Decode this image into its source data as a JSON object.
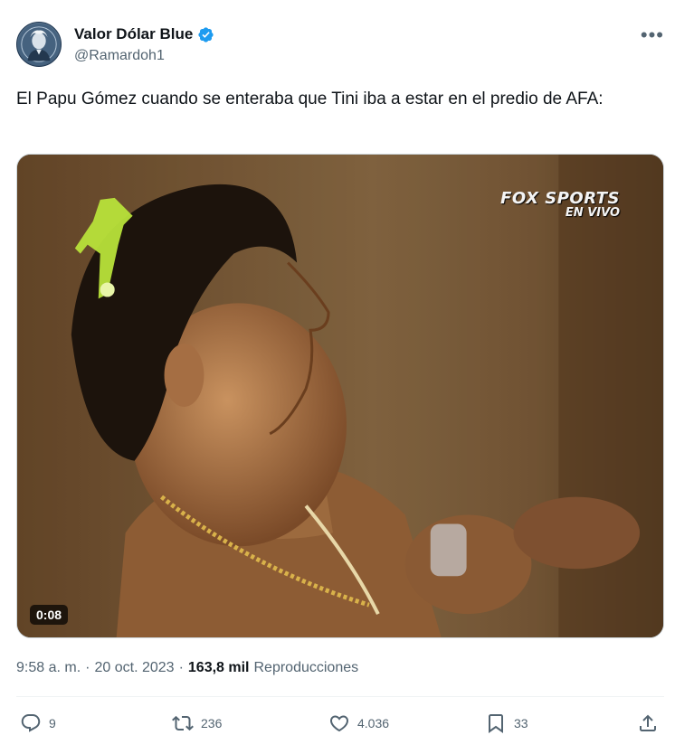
{
  "author": {
    "display_name": "Valor Dólar Blue",
    "handle": "@Ramardoh1",
    "verified": true,
    "avatar_icon": "dollar-portrait-avatar"
  },
  "more_icon": "more-horizontal-icon",
  "tweet": {
    "text": "El Papu Gómez cuando se enteraba que Tini iba a estar en el predio de AFA:"
  },
  "media": {
    "type": "video",
    "duration": "0:08",
    "watermark_line1": "FOX SPORTS",
    "watermark_line2": "EN VIVO"
  },
  "meta": {
    "time": "9:58 a. m.",
    "separator": "·",
    "date": "20 oct. 2023",
    "separator2": "·",
    "views_count": "163,8 mil",
    "views_label": "Reproducciones"
  },
  "actions": {
    "reply_count": "9",
    "retweet_count": "236",
    "like_count": "4.036",
    "bookmark_count": "33"
  },
  "colors": {
    "accent": "#1d9bf0",
    "secondary_text": "#536471",
    "primary_text": "#0f1419"
  }
}
